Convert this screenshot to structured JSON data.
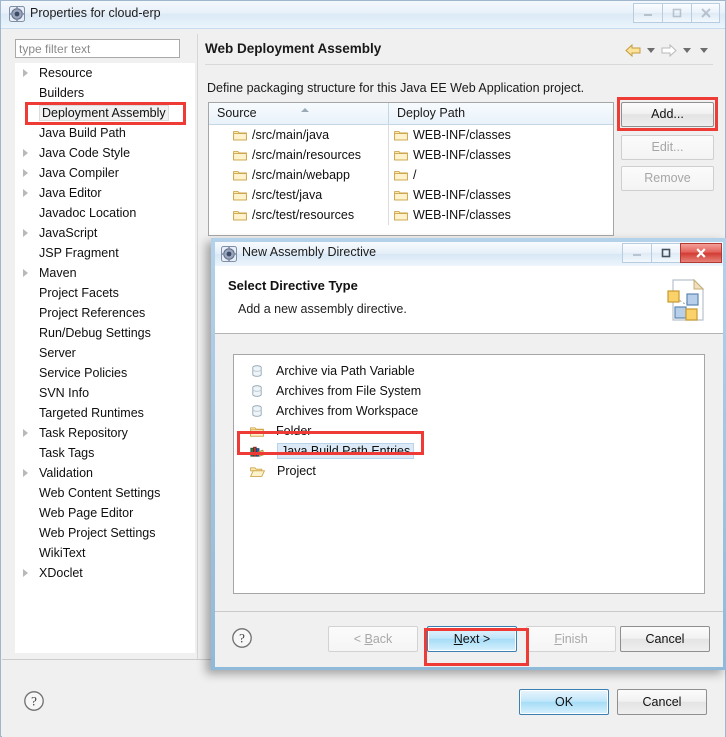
{
  "window": {
    "title": "Properties for cloud-erp",
    "icon": "eclipse-properties-icon",
    "buttons": {
      "minimize": "minimize-icon",
      "maximize": "maximize-icon",
      "close": "close-icon"
    }
  },
  "sidebar": {
    "filter": {
      "value": "",
      "placeholder": "type filter text"
    },
    "items": [
      {
        "label": "Resource",
        "expandable": true,
        "selected": false
      },
      {
        "label": "Builders",
        "expandable": false,
        "selected": false
      },
      {
        "label": "Deployment Assembly",
        "expandable": false,
        "selected": true
      },
      {
        "label": "Java Build Path",
        "expandable": false,
        "selected": false
      },
      {
        "label": "Java Code Style",
        "expandable": true,
        "selected": false
      },
      {
        "label": "Java Compiler",
        "expandable": true,
        "selected": false
      },
      {
        "label": "Java Editor",
        "expandable": true,
        "selected": false
      },
      {
        "label": "Javadoc Location",
        "expandable": false,
        "selected": false
      },
      {
        "label": "JavaScript",
        "expandable": true,
        "selected": false
      },
      {
        "label": "JSP Fragment",
        "expandable": false,
        "selected": false
      },
      {
        "label": "Maven",
        "expandable": true,
        "selected": false
      },
      {
        "label": "Project Facets",
        "expandable": false,
        "selected": false
      },
      {
        "label": "Project References",
        "expandable": false,
        "selected": false
      },
      {
        "label": "Run/Debug Settings",
        "expandable": false,
        "selected": false
      },
      {
        "label": "Server",
        "expandable": false,
        "selected": false
      },
      {
        "label": "Service Policies",
        "expandable": false,
        "selected": false
      },
      {
        "label": "SVN Info",
        "expandable": false,
        "selected": false
      },
      {
        "label": "Targeted Runtimes",
        "expandable": false,
        "selected": false
      },
      {
        "label": "Task Repository",
        "expandable": true,
        "selected": false
      },
      {
        "label": "Task Tags",
        "expandable": false,
        "selected": false
      },
      {
        "label": "Validation",
        "expandable": true,
        "selected": false
      },
      {
        "label": "Web Content Settings",
        "expandable": false,
        "selected": false
      },
      {
        "label": "Web Page Editor",
        "expandable": false,
        "selected": false
      },
      {
        "label": "Web Project Settings",
        "expandable": false,
        "selected": false
      },
      {
        "label": "WikiText",
        "expandable": false,
        "selected": false
      },
      {
        "label": "XDoclet",
        "expandable": true,
        "selected": false
      }
    ]
  },
  "page": {
    "title": "Web Deployment Assembly",
    "description": "Define packaging structure for this Java EE Web Application project.",
    "nav": {
      "back": "back-arrow-icon",
      "forward": "forward-arrow-icon",
      "menu": "dropdown-caret-icon"
    },
    "table": {
      "columns": [
        "Source",
        "Deploy Path"
      ],
      "sort": "ascending",
      "rows": [
        {
          "source": "/src/main/java",
          "deploy": "WEB-INF/classes"
        },
        {
          "source": "/src/main/resources",
          "deploy": "WEB-INF/classes"
        },
        {
          "source": "/src/main/webapp",
          "deploy": "/"
        },
        {
          "source": "/src/test/java",
          "deploy": "WEB-INF/classes"
        },
        {
          "source": "/src/test/resources",
          "deploy": "WEB-INF/classes"
        }
      ]
    },
    "side_buttons": [
      {
        "label": "Add...",
        "enabled": true
      },
      {
        "label": "Edit...",
        "enabled": false
      },
      {
        "label": "Remove",
        "enabled": false
      }
    ],
    "footer": {
      "help": "help-icon",
      "ok": "OK",
      "cancel": "Cancel"
    }
  },
  "dialog": {
    "title": "New Assembly Directive",
    "icon": "eclipse-wizard-icon",
    "heading": "Select Directive Type",
    "subheading": "Add a new assembly directive.",
    "banner_icon": "assembly-directive-banner-icon",
    "buttons": {
      "minimize": "minimize-icon",
      "maximize": "maximize-icon",
      "close": "close-icon"
    },
    "options": [
      {
        "label": "Archive via Path Variable",
        "icon": "jar-icon",
        "selected": false
      },
      {
        "label": "Archives from File System",
        "icon": "jar-icon",
        "selected": false
      },
      {
        "label": "Archives from Workspace",
        "icon": "jar-icon",
        "selected": false
      },
      {
        "label": "Folder",
        "icon": "folder-icon",
        "selected": false
      },
      {
        "label": "Java Build Path Entries",
        "icon": "library-icon",
        "selected": true
      },
      {
        "label": "Project",
        "icon": "open-folder-icon",
        "selected": false
      }
    ],
    "footer": {
      "help": "help-icon",
      "back": {
        "label": "< Back",
        "mnemonic": "B",
        "enabled": false,
        "default": false
      },
      "next": {
        "label": "Next >",
        "mnemonic": "N",
        "enabled": true,
        "default": true
      },
      "finish": {
        "label": "Finish",
        "mnemonic": "F",
        "enabled": false,
        "default": false
      },
      "cancel": {
        "label": "Cancel",
        "mnemonic": "",
        "enabled": true,
        "default": false
      }
    }
  },
  "annotations": {
    "color": "#ef3b36",
    "highlights": [
      "sidebar-item-deployment-assembly",
      "add-button",
      "directive-option-java-build-path-entries",
      "next-button"
    ]
  }
}
